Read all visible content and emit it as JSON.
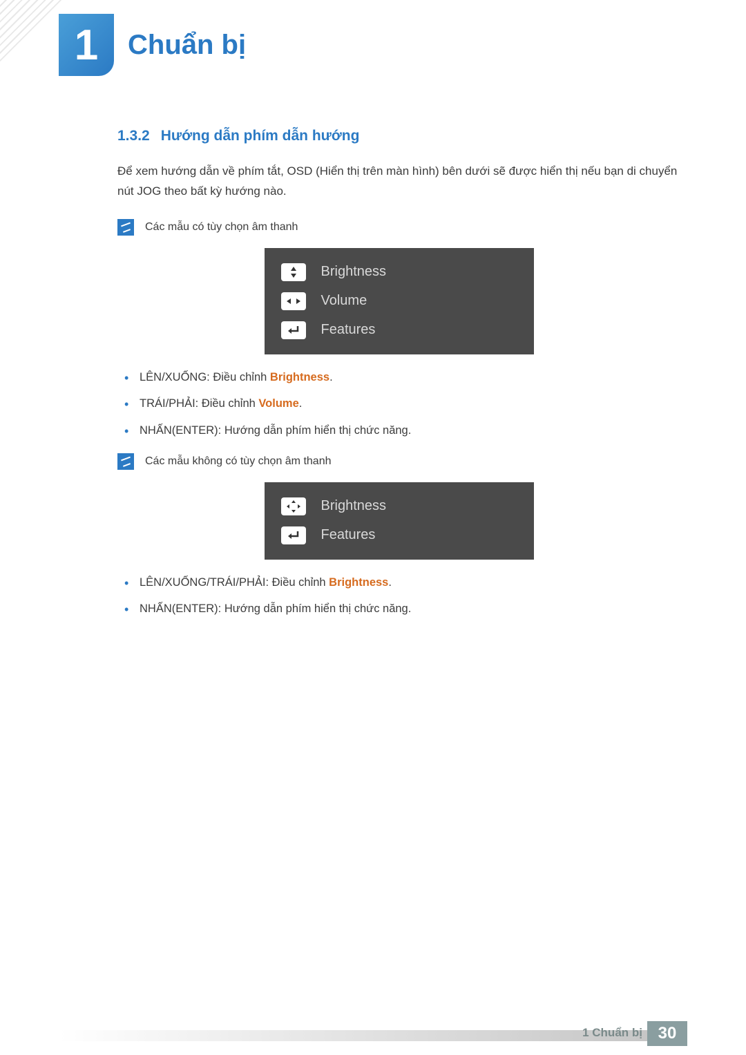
{
  "chapter": {
    "number": "1",
    "title": "Chuẩn bị"
  },
  "section": {
    "number": "1.3.2",
    "title": "Hướng dẫn phím dẫn hướng"
  },
  "intro": "Để xem hướng dẫn về phím tắt, OSD (Hiển thị trên màn hình) bên dưới sẽ được hiển thị nếu bạn di chuyển nút JOG theo bất kỳ hướng nào.",
  "note1": "Các mẫu có tùy chọn âm thanh",
  "osd1": {
    "row1": "Brightness",
    "row2": "Volume",
    "row3": "Features"
  },
  "bullets1": {
    "item1_prefix": "LÊN/XUỐNG: Điều chỉnh ",
    "item1_highlight": "Brightness",
    "item1_suffix": ".",
    "item2_prefix": "TRÁI/PHẢI: Điều chỉnh ",
    "item2_highlight": "Volume",
    "item2_suffix": ".",
    "item3": "NHẤN(ENTER): Hướng dẫn phím hiển thị chức năng."
  },
  "note2": "Các mẫu không có tùy chọn âm thanh",
  "osd2": {
    "row1": "Brightness",
    "row2": "Features"
  },
  "bullets2": {
    "item1_prefix": "LÊN/XUỐNG/TRÁI/PHẢI: Điều chỉnh ",
    "item1_highlight": "Brightness",
    "item1_suffix": ".",
    "item2": "NHẤN(ENTER): Hướng dẫn phím hiển thị chức năng."
  },
  "footer": {
    "label": "1 Chuẩn bị",
    "page": "30"
  }
}
